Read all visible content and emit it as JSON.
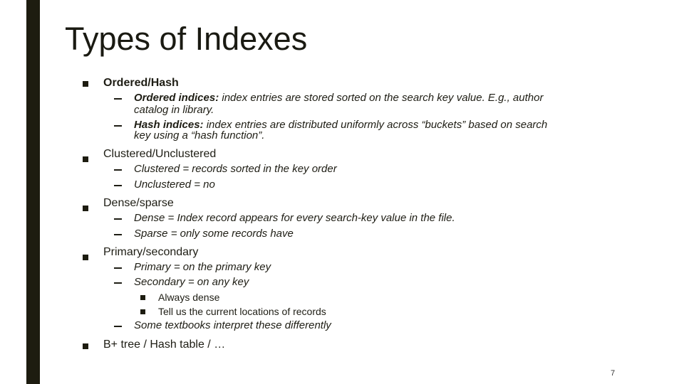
{
  "slide": {
    "title": "Types of Indexes",
    "page_number": "7"
  },
  "items": [
    {
      "label": "Ordered/Hash",
      "subitems": [
        {
          "lead": "Ordered indices:",
          "text": "  index entries are stored sorted on the search key value.  E.g., author",
          "cont": "catalog in library."
        },
        {
          "lead": "Hash indices:",
          "text": " index entries are distributed uniformly across “buckets” based on search",
          "cont": "key using a “hash function”."
        }
      ]
    },
    {
      "label": "Clustered/Unclustered",
      "subitems": [
        {
          "text": "Clustered = records sorted in the key order"
        },
        {
          "text": "Unclustered = no"
        }
      ]
    },
    {
      "label": "Dense/sparse",
      "subitems": [
        {
          "text": "Dense = Index record appears for every search-key value in the file."
        },
        {
          "text": "Sparse = only some records have"
        }
      ]
    },
    {
      "label": "Primary/secondary",
      "subitems": [
        {
          "text": "Primary = on the primary key"
        },
        {
          "text": "Secondary = on any key",
          "subitems": [
            "Always dense",
            "Tell us the current locations of records"
          ]
        },
        {
          "text": "Some textbooks interpret these differently"
        }
      ]
    },
    {
      "label": "B+ tree / Hash table / …"
    }
  ]
}
